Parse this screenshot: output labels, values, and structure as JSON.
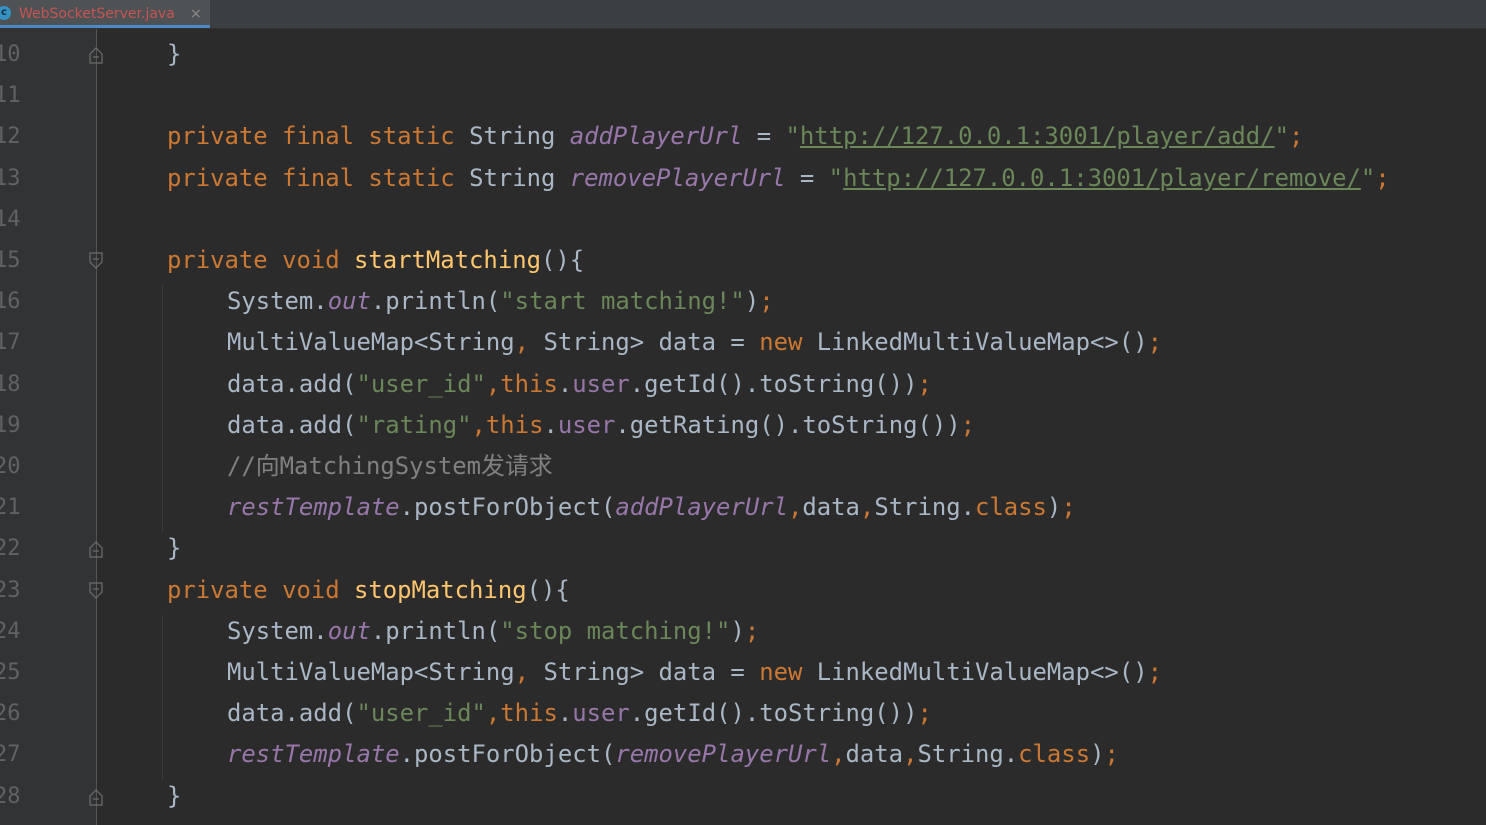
{
  "tab": {
    "filename": "WebSocketServer.java",
    "icon": "c-class-icon",
    "close": "×",
    "icon_letter": "c"
  },
  "lines": [
    {
      "num": "10",
      "fold": "end",
      "tokens": [
        {
          "t": "}"
        }
      ]
    },
    {
      "num": "11",
      "tokens": []
    },
    {
      "num": "12",
      "tokens": [
        {
          "t": "private final static ",
          "c": "kw"
        },
        {
          "t": "String "
        },
        {
          "t": "addPlayerUrl",
          "c": "fld"
        },
        {
          "t": " = "
        },
        {
          "t": "\"",
          "c": "str"
        },
        {
          "t": "http://127.0.0.1:3001/player/add/",
          "c": "str url"
        },
        {
          "t": "\"",
          "c": "str"
        },
        {
          "t": ";",
          "c": "kw"
        }
      ]
    },
    {
      "num": "13",
      "tokens": [
        {
          "t": "private final static ",
          "c": "kw"
        },
        {
          "t": "String "
        },
        {
          "t": "removePlayerUrl",
          "c": "fld"
        },
        {
          "t": " = "
        },
        {
          "t": "\"",
          "c": "str"
        },
        {
          "t": "http://127.0.0.1:3001/player/remove/",
          "c": "str url"
        },
        {
          "t": "\"",
          "c": "str"
        },
        {
          "t": ";",
          "c": "kw"
        }
      ]
    },
    {
      "num": "14",
      "tokens": []
    },
    {
      "num": "15",
      "fold": "start",
      "tokens": [
        {
          "t": "private void ",
          "c": "kw"
        },
        {
          "t": "startMatching",
          "c": "fn"
        },
        {
          "t": "(){"
        }
      ]
    },
    {
      "num": "16",
      "indent": 1,
      "tokens": [
        {
          "t": "System."
        },
        {
          "t": "out",
          "c": "fld"
        },
        {
          "t": ".println("
        },
        {
          "t": "\"start matching!\"",
          "c": "str"
        },
        {
          "t": ")"
        },
        {
          "t": ";",
          "c": "kw"
        }
      ]
    },
    {
      "num": "17",
      "indent": 1,
      "tokens": [
        {
          "t": "MultiValueMap<String"
        },
        {
          "t": ", ",
          "c": "kw"
        },
        {
          "t": "String> data = "
        },
        {
          "t": "new ",
          "c": "kw"
        },
        {
          "t": "LinkedMultiValueMap<>()"
        },
        {
          "t": ";",
          "c": "kw"
        }
      ]
    },
    {
      "num": "18",
      "indent": 1,
      "tokens": [
        {
          "t": "data.add("
        },
        {
          "t": "\"user_id\"",
          "c": "str"
        },
        {
          "t": ",",
          "c": "kw"
        },
        {
          "t": "this",
          "c": "kw"
        },
        {
          "t": "."
        },
        {
          "t": "user",
          "c": "inst"
        },
        {
          "t": ".getId().toString())"
        },
        {
          "t": ";",
          "c": "kw"
        }
      ]
    },
    {
      "num": "19",
      "indent": 1,
      "tokens": [
        {
          "t": "data.add("
        },
        {
          "t": "\"rating\"",
          "c": "str"
        },
        {
          "t": ",",
          "c": "kw"
        },
        {
          "t": "this",
          "c": "kw"
        },
        {
          "t": "."
        },
        {
          "t": "user",
          "c": "inst"
        },
        {
          "t": ".getRating().toString())"
        },
        {
          "t": ";",
          "c": "kw"
        }
      ]
    },
    {
      "num": "20",
      "indent": 1,
      "tokens": [
        {
          "t": "//向MatchingSystem发请求",
          "c": "cmt"
        }
      ]
    },
    {
      "num": "21",
      "indent": 1,
      "tokens": [
        {
          "t": "restTemplate",
          "c": "fld"
        },
        {
          "t": ".postForObject("
        },
        {
          "t": "addPlayerUrl",
          "c": "fld"
        },
        {
          "t": ",",
          "c": "kw"
        },
        {
          "t": "data"
        },
        {
          "t": ",",
          "c": "kw"
        },
        {
          "t": "String."
        },
        {
          "t": "class",
          "c": "kw"
        },
        {
          "t": ")"
        },
        {
          "t": ";",
          "c": "kw"
        }
      ]
    },
    {
      "num": "22",
      "fold": "end",
      "tokens": [
        {
          "t": "}"
        }
      ]
    },
    {
      "num": "23",
      "fold": "start",
      "tokens": [
        {
          "t": "private void ",
          "c": "kw"
        },
        {
          "t": "stopMatching",
          "c": "fn"
        },
        {
          "t": "(){"
        }
      ]
    },
    {
      "num": "24",
      "indent": 1,
      "tokens": [
        {
          "t": "System."
        },
        {
          "t": "out",
          "c": "fld"
        },
        {
          "t": ".println("
        },
        {
          "t": "\"stop matching!\"",
          "c": "str"
        },
        {
          "t": ")"
        },
        {
          "t": ";",
          "c": "kw"
        }
      ]
    },
    {
      "num": "25",
      "indent": 1,
      "tokens": [
        {
          "t": "MultiValueMap<String"
        },
        {
          "t": ", ",
          "c": "kw"
        },
        {
          "t": "String> data = "
        },
        {
          "t": "new ",
          "c": "kw"
        },
        {
          "t": "LinkedMultiValueMap<>()"
        },
        {
          "t": ";",
          "c": "kw"
        }
      ]
    },
    {
      "num": "26",
      "indent": 1,
      "tokens": [
        {
          "t": "data.add("
        },
        {
          "t": "\"user_id\"",
          "c": "str"
        },
        {
          "t": ",",
          "c": "kw"
        },
        {
          "t": "this",
          "c": "kw"
        },
        {
          "t": "."
        },
        {
          "t": "user",
          "c": "inst"
        },
        {
          "t": ".getId().toString())"
        },
        {
          "t": ";",
          "c": "kw"
        }
      ]
    },
    {
      "num": "27",
      "indent": 1,
      "tokens": [
        {
          "t": "restTemplate",
          "c": "fld"
        },
        {
          "t": ".postForObject("
        },
        {
          "t": "removePlayerUrl",
          "c": "fld"
        },
        {
          "t": ",",
          "c": "kw"
        },
        {
          "t": "data"
        },
        {
          "t": ",",
          "c": "kw"
        },
        {
          "t": "String."
        },
        {
          "t": "class",
          "c": "kw"
        },
        {
          "t": ")"
        },
        {
          "t": ";",
          "c": "kw"
        }
      ]
    },
    {
      "num": "28",
      "fold": "end",
      "tokens": [
        {
          "t": "}"
        }
      ]
    }
  ],
  "colors": {
    "background": "#2b2b2b",
    "gutter": "#313335",
    "keyword": "#cc7832",
    "string": "#6a8759",
    "field": "#9876aa",
    "method_decl": "#ffc66d",
    "comment": "#808080",
    "text": "#a9b7c6",
    "line_number": "#606366",
    "tab_filename": "#c75450"
  }
}
